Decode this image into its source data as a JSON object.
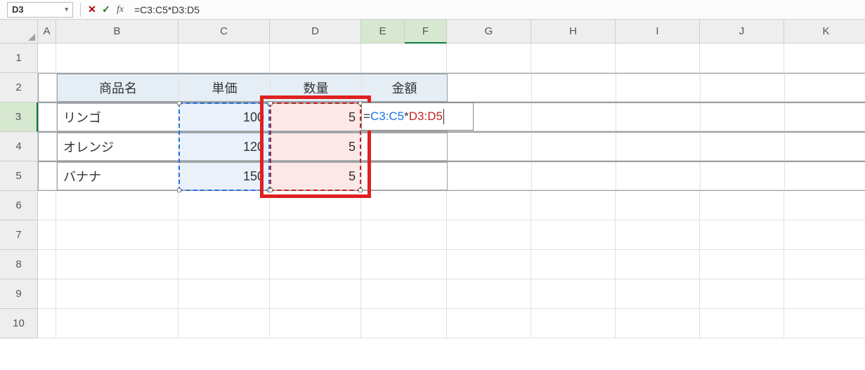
{
  "name_box": {
    "value": "D3"
  },
  "formula_bar": {
    "raw": "=C3:C5*D3:D5",
    "eq": "=",
    "ref1": "C3:C5",
    "op": "*",
    "ref2": "D3:D5"
  },
  "columns": [
    "A",
    "B",
    "C",
    "D",
    "E",
    "F",
    "G",
    "H",
    "I",
    "J",
    "K"
  ],
  "rows": [
    "1",
    "2",
    "3",
    "4",
    "5",
    "6",
    "7",
    "8",
    "9",
    "10"
  ],
  "table": {
    "headers": {
      "b": "商品名",
      "c": "単価",
      "d": "数量",
      "e": "金額"
    },
    "rows": [
      {
        "name": "リンゴ",
        "price": "100",
        "qty": "5"
      },
      {
        "name": "オレンジ",
        "price": "120",
        "qty": "5"
      },
      {
        "name": "バナナ",
        "price": "150",
        "qty": "5"
      }
    ]
  },
  "icons": {
    "dropdown": "▾",
    "cancel": "✕",
    "ok": "✓",
    "fx": "fx"
  }
}
